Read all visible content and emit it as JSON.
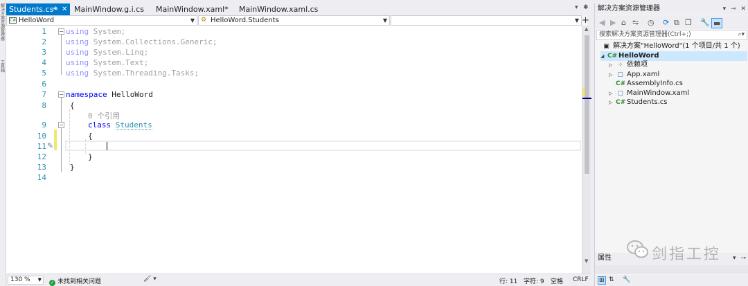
{
  "left_strip": {
    "text1": "解决方案资源管理器",
    "text2": "工具箱"
  },
  "tabs": [
    {
      "label": "Students.cs*",
      "active": true
    },
    {
      "label": "MainWindow.g.i.cs",
      "active": false
    },
    {
      "label": "MainWindow.xaml*",
      "active": false
    },
    {
      "label": "MainWindow.xaml.cs",
      "active": false
    }
  ],
  "tab_icons": {
    "pin": "📌",
    "close": "✕",
    "overflow": "▾",
    "settings": "✱"
  },
  "navbar": {
    "project": "HelloWord",
    "type": "HelloWord.Students",
    "member": "",
    "add": "+"
  },
  "editor": {
    "line_numbers": [
      "1",
      "2",
      "3",
      "4",
      "5",
      "6",
      "7",
      "8",
      "9",
      "10",
      "11",
      "12",
      "13",
      "14"
    ],
    "lines": {
      "l1_kw": "using",
      "l1_rest": " System;",
      "l2_kw": "using",
      "l2_rest": " System.Collections.Generic;",
      "l3_kw": "using",
      "l3_rest": " System.Linq;",
      "l4_kw": "using",
      "l4_rest": " System.Text;",
      "l5_kw": "using",
      "l5_rest": " System.Threading.Tasks;",
      "l7_kw": "namespace",
      "l7_rest": " HelloWord",
      "l8": "{",
      "codelens": "0 个引用",
      "l9_kw": "class",
      "l9_type": "Students",
      "l10": "{",
      "l12": "}",
      "l13": "}"
    }
  },
  "statusbar": {
    "zoom": "130 %",
    "issues": "未找到相关问题",
    "line": "行: 11",
    "col": "字符: 9",
    "mode": "空格",
    "eol": "CRLF"
  },
  "solution_explorer": {
    "title": "解决方案资源管理器",
    "search_placeholder": "搜索解决方案资源管理器(Ctrl+;)",
    "tree": [
      {
        "label": "解决方案\"HelloWord\"(1 个项目/共 1 个)"
      },
      {
        "label": "HelloWord"
      },
      {
        "label": "依赖项"
      },
      {
        "label": "App.xaml"
      },
      {
        "label": "AssemblyInfo.cs"
      },
      {
        "label": "MainWindow.xaml"
      },
      {
        "label": "Students.cs"
      }
    ]
  },
  "properties": {
    "title": "属性"
  },
  "watermark": {
    "text": "剑指工控"
  },
  "colors": {
    "accent": "#007acc",
    "keyword": "#0000ff",
    "type": "#2b91af",
    "linenumber": "#2b91af",
    "change": "#f0e96b"
  }
}
